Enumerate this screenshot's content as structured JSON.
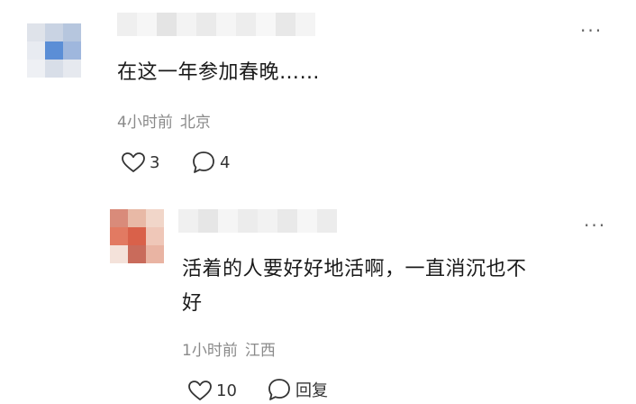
{
  "comments": [
    {
      "text": "在这一年参加春晚……",
      "time": "4小时前",
      "location": "北京",
      "like_count": "3",
      "reply_count": "4",
      "more_label": "···",
      "avatar_colors": [
        "#dfe3ea",
        "#c9d3e3",
        "#b6c6de",
        "#e8ebf1",
        "#5b8ed6",
        "#9fb7dd",
        "#eef0f4",
        "#d8dee8",
        "#e6e9ef"
      ]
    },
    {
      "text_line1": "活着的人要好好地活啊，一直消沉也不",
      "text_line2": "好",
      "time": "1小时前",
      "location": "江西",
      "like_count": "10",
      "reply_label": "回复",
      "more_label": "···",
      "avatar_colors": [
        "#d98b7a",
        "#e8b9a6",
        "#f1d6c9",
        "#e27a62",
        "#d9614a",
        "#efc7b8",
        "#f4e2da",
        "#c96b5b",
        "#e9b4a3"
      ]
    }
  ],
  "colors": {
    "text": "#1a1a1a",
    "meta": "#8a8a8a",
    "icon": "#333333"
  }
}
